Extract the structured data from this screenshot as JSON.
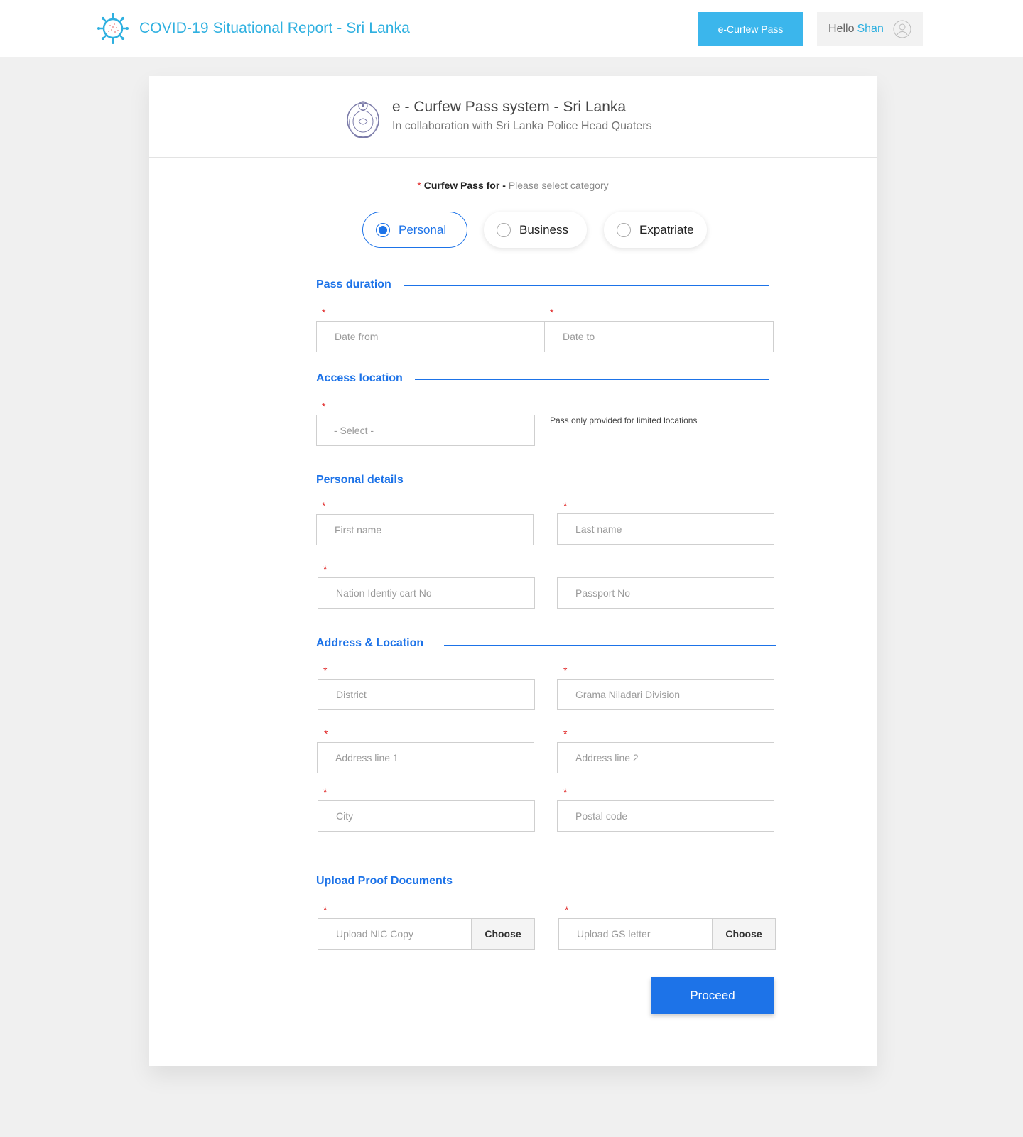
{
  "header": {
    "title": "COVID-19 Situational Report - Sri Lanka",
    "curfew_button": "e-Curfew Pass",
    "greeting": "Hello",
    "user_name": "Shan",
    "accent_color": "#2fb0e0"
  },
  "card": {
    "title": "e - Curfew Pass system - Sri Lanka",
    "subtitle": "In collaboration with Sri Lanka Police Head Quaters",
    "category_label": "Curfew Pass for -",
    "category_hint": "Please select category",
    "required_mark": "*",
    "categories": [
      {
        "label": "Personal",
        "selected": true
      },
      {
        "label": "Business",
        "selected": false
      },
      {
        "label": "Expatriate",
        "selected": false
      }
    ]
  },
  "sections": {
    "pass_duration": "Pass duration",
    "access_location": "Access location",
    "personal_details": "Personal details",
    "address_location": "Address & Location",
    "upload_docs": "Upload Proof Documents"
  },
  "fields": {
    "date_from": "Date from",
    "date_to": "Date to",
    "location_select": "- Select -",
    "location_note": "Pass only provided for limited locations",
    "first_name": "First name",
    "last_name": "Last name",
    "nic": "Nation Identiy cart No",
    "passport": "Passport No",
    "district": "District",
    "gn_division": "Grama Niladari Division",
    "address1": "Address line 1",
    "address2": "Address line 2",
    "city": "City",
    "postal": "Postal code",
    "upload_nic": "Upload NIC Copy",
    "upload_gs": "Upload GS letter",
    "choose": "Choose"
  },
  "actions": {
    "proceed": "Proceed"
  },
  "colors": {
    "primary": "#1d73e8",
    "required": "#e02424",
    "curfew_button": "#3bb6ec"
  }
}
